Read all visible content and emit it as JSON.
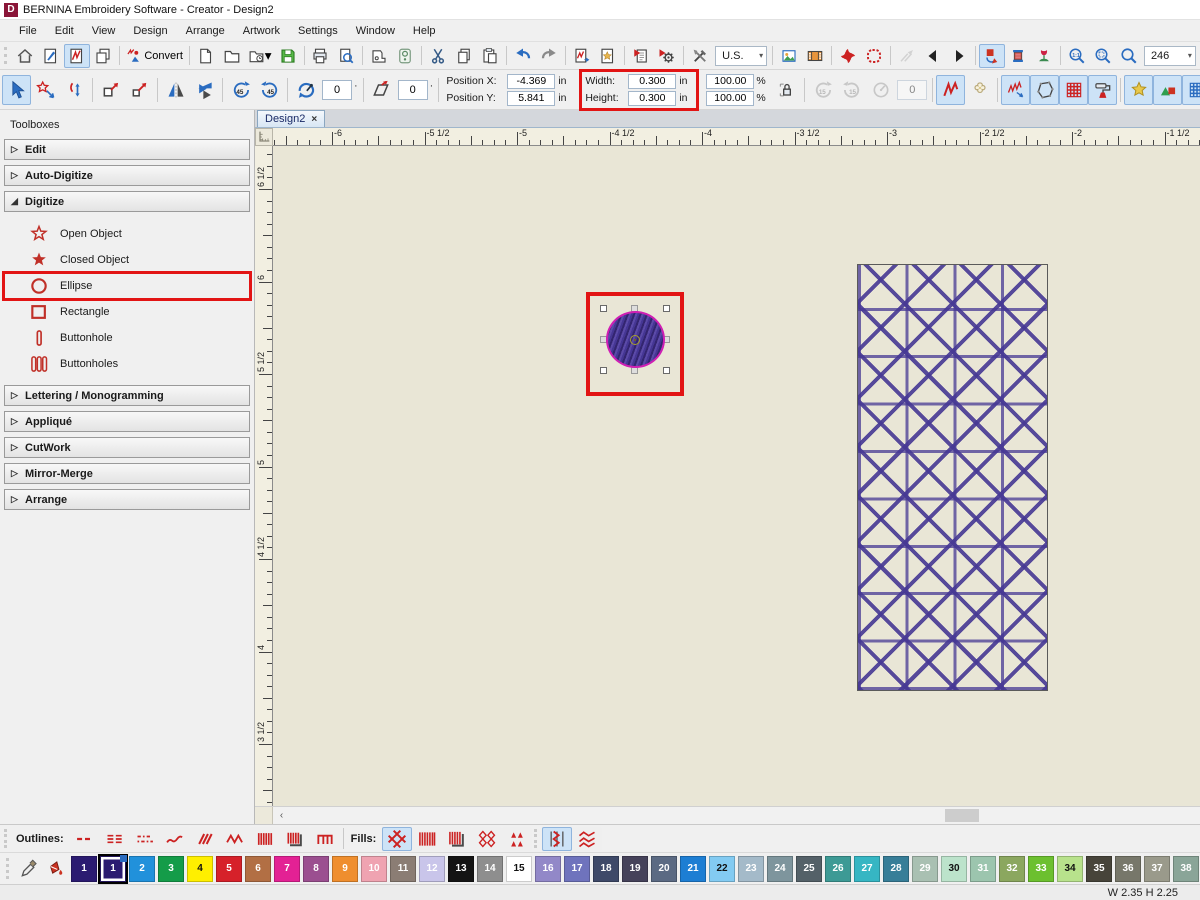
{
  "window": {
    "logo_letter": "D",
    "title": "BERNINA Embroidery Software - Creator - Design2"
  },
  "menu": {
    "items": [
      "File",
      "Edit",
      "View",
      "Design",
      "Arrange",
      "Artwork",
      "Settings",
      "Window",
      "Help"
    ]
  },
  "toolbar_main": {
    "groups": [
      {
        "items": [
          {
            "name": "home-button",
            "icon": "home"
          },
          {
            "name": "artwork-canvas-button",
            "icon": "pageBrush"
          },
          {
            "name": "embroidery-canvas-button",
            "icon": "pageStitch",
            "hl": true
          },
          {
            "name": "multi-hooping-button",
            "icon": "pages"
          }
        ]
      },
      {
        "items": [
          {
            "name": "convert-button",
            "icon": "convert",
            "label": "Convert"
          }
        ]
      },
      {
        "items": [
          {
            "name": "new-design-button",
            "icon": "pageNew"
          },
          {
            "name": "open-design-button",
            "icon": "folder"
          },
          {
            "name": "open-recent-button",
            "icon": "folderClock",
            "arrow": true
          },
          {
            "name": "save-design-button",
            "icon": "floppy"
          }
        ]
      },
      {
        "items": [
          {
            "name": "print-button",
            "icon": "printer"
          },
          {
            "name": "print-preview-button",
            "icon": "pageZoom"
          }
        ]
      },
      {
        "items": [
          {
            "name": "write-to-machine-button",
            "icon": "machine"
          },
          {
            "name": "send-to-hoop-button",
            "icon": "hoopDevice"
          }
        ]
      },
      {
        "items": [
          {
            "name": "cut-button",
            "icon": "cut"
          },
          {
            "name": "copy-button",
            "icon": "copy"
          },
          {
            "name": "paste-button",
            "icon": "paste"
          }
        ]
      },
      {
        "items": [
          {
            "name": "undo-button",
            "icon": "undo"
          },
          {
            "name": "redo-button",
            "icon": "redo"
          }
        ]
      },
      {
        "items": [
          {
            "name": "insert-embroidery-button",
            "icon": "pageZig"
          },
          {
            "name": "insert-artwork-button",
            "icon": "pageStar"
          }
        ]
      },
      {
        "items": [
          {
            "name": "design-properties-button",
            "icon": "docRed"
          },
          {
            "name": "options-button",
            "icon": "gearRed"
          }
        ]
      },
      {
        "items": [
          {
            "name": "quick-tools-button",
            "icon": "tools"
          },
          {
            "name": "units-combo",
            "combo": "U.S."
          }
        ]
      },
      {
        "items": [
          {
            "name": "background-picture-button",
            "icon": "picture"
          },
          {
            "name": "film-strip-button",
            "icon": "film"
          }
        ]
      },
      {
        "items": [
          {
            "name": "stitch-player-button",
            "icon": "pinwheel"
          },
          {
            "name": "show-hoop-button",
            "icon": "hoopDashed"
          }
        ]
      },
      {
        "items": [
          {
            "name": "slow-redraw-button",
            "icon": "slowRedraw",
            "dis": true
          },
          {
            "name": "previous-color-button",
            "icon": "triLeft"
          },
          {
            "name": "next-color-button",
            "icon": "triRight"
          }
        ]
      },
      {
        "items": [
          {
            "name": "color-change-button",
            "icon": "colorChange",
            "hl": true
          },
          {
            "name": "thread-colors-button",
            "icon": "spool"
          },
          {
            "name": "my-threads-button",
            "icon": "flowerRed"
          }
        ]
      },
      {
        "items": [
          {
            "name": "zoom-1to1-button",
            "icon": "zoom11"
          },
          {
            "name": "zoom-to-fit-button",
            "icon": "zoomFit"
          },
          {
            "name": "zoom-button",
            "icon": "zoomMag"
          },
          {
            "name": "zoom-level-combo",
            "combo": "246"
          }
        ]
      }
    ]
  },
  "toolbar_transform": {
    "items_a": [
      {
        "name": "select-button",
        "icon": "arrowSelect",
        "hl": true
      },
      {
        "name": "reshape-button",
        "icon": "reshapeStar"
      },
      {
        "name": "transform-node-button",
        "icon": "transformNode"
      },
      {
        "sep": true
      },
      {
        "name": "scale-handles-button",
        "icon": "scaleBox1"
      },
      {
        "name": "scale-center-button",
        "icon": "scaleBox2"
      },
      {
        "sep": true
      },
      {
        "name": "mirror-horizontal-button",
        "icon": "mirrorH"
      },
      {
        "name": "mirror-vertical-button",
        "icon": "mirrorV"
      },
      {
        "sep": true
      },
      {
        "name": "rotate-ccw-45-button",
        "icon": "rot45l"
      },
      {
        "name": "rotate-cw-45-button",
        "icon": "rot45r"
      },
      {
        "sep": true
      },
      {
        "name": "rotate-tool-button",
        "icon": "rotateFree"
      },
      {
        "name": "rotate-angle-input",
        "input": "0"
      },
      {
        "dot": true
      },
      {
        "sep": true
      },
      {
        "name": "skew-tool-button",
        "icon": "skew"
      },
      {
        "name": "skew-angle-input",
        "input": "0"
      },
      {
        "dot": true
      },
      {
        "sep": true
      }
    ],
    "items_b": [
      {
        "sep": true
      },
      {
        "name": "rotate-15-ccw-button",
        "icon": "rot15l",
        "dis": true
      },
      {
        "name": "rotate-15-cw-button",
        "icon": "rot15r",
        "dis": true
      },
      {
        "name": "rotate-dial-button",
        "icon": "dialGray",
        "dis": true
      },
      {
        "name": "rotate-dial-input",
        "input": "0",
        "dis": true
      },
      {
        "sep": true
      },
      {
        "name": "stitch-type-button",
        "icon": "zigzagRed",
        "hl": true
      },
      {
        "name": "craft-stitch-button",
        "icon": "flowerOutline"
      },
      {
        "sep": true
      },
      {
        "name": "show-stitches-button",
        "icon": "stitchesSmall",
        "hl": true
      },
      {
        "name": "show-outlines-button",
        "icon": "polygonIcon",
        "hl": true
      },
      {
        "name": "show-needle-points-button",
        "icon": "gridRed",
        "hl": true
      },
      {
        "name": "show-connectors-button",
        "icon": "roller",
        "hl": true
      },
      {
        "sep": true
      },
      {
        "name": "show-artwork-button",
        "icon": "starYellow",
        "hl": true
      },
      {
        "name": "show-vectors-button",
        "icon": "artShapes",
        "hl": true
      },
      {
        "name": "show-grid-overlay-button",
        "icon": "gridBlue",
        "hl": true
      },
      {
        "sep": true
      },
      {
        "name": "show-hoop-button-2",
        "icon": "hoopBlue"
      },
      {
        "name": "hoop-template-button",
        "icon": "hoopGrid"
      },
      {
        "name": "show-grid-button",
        "icon": "gridGray"
      },
      {
        "name": "show-rulers-button",
        "icon": "rulerIcon",
        "hl": true
      },
      {
        "sep": true
      },
      {
        "name": "overflow-button",
        "icon": "zigzagRed"
      }
    ],
    "position_x_label": "Position X:",
    "position_x_value": "-4.369",
    "position_x_unit": "in",
    "position_y_label": "Position Y:",
    "position_y_value": "5.841",
    "position_y_unit": "in",
    "width_label": "Width:",
    "width_value": "0.300",
    "width_unit": "in",
    "height_label": "Height:",
    "height_value": "0.300",
    "height_unit": "in",
    "scale_x_value": "100.00",
    "scale_x_unit": "%",
    "scale_y_value": "100.00",
    "scale_y_unit": "%"
  },
  "sidebar": {
    "title": "Toolboxes",
    "sections": [
      {
        "label": "Edit",
        "expanded": false
      },
      {
        "label": "Auto-Digitize",
        "expanded": false
      },
      {
        "label": "Digitize",
        "expanded": true,
        "items": [
          {
            "label": "Open Object",
            "icon": "starOpen",
            "name": "tool-open-object"
          },
          {
            "label": "Closed Object",
            "icon": "starFill",
            "name": "tool-closed-object"
          },
          {
            "label": "Ellipse",
            "icon": "circleO",
            "name": "tool-ellipse",
            "annotated": true
          },
          {
            "label": "Rectangle",
            "icon": "rectO",
            "name": "tool-rectangle"
          },
          {
            "label": "Buttonhole",
            "icon": "bh1",
            "name": "tool-buttonhole"
          },
          {
            "label": "Buttonholes",
            "icon": "bh3",
            "name": "tool-buttonholes"
          }
        ]
      },
      {
        "label": "Lettering / Monogramming",
        "expanded": false
      },
      {
        "label": "Appliqué",
        "expanded": false
      },
      {
        "label": "CutWork",
        "expanded": false
      },
      {
        "label": "Mirror-Merge",
        "expanded": false
      },
      {
        "label": "Arrange",
        "expanded": false
      }
    ]
  },
  "canvas": {
    "tab_label": "Design2",
    "tab_close": "×",
    "scroll_left_arrow": "‹",
    "ruler_h_labels": [
      "-6",
      "-5 1/2",
      "-5",
      "-4 1/2",
      "-4",
      "-3 1/2",
      "-3",
      "-2 1/2",
      "-2",
      "-1 1/2"
    ],
    "ruler_v_labels": [
      "6 1/2",
      "6",
      "5 1/2",
      "5",
      "4 1/2",
      "4",
      "3 1/2"
    ],
    "objects": {
      "selected_circle": {
        "fill_color": "#453694",
        "outline_color": "#cf1fb4",
        "width_in": "0.300",
        "height_in": "0.300"
      },
      "lattice_rectangle": {
        "fill_color": "#463894"
      }
    }
  },
  "stitch_bar": {
    "outlines_label": "Outlines:",
    "outline_icons": [
      {
        "name": "outline-single",
        "icon": "oRun"
      },
      {
        "name": "outline-triple",
        "icon": "oTriple"
      },
      {
        "name": "outline-sculpture",
        "icon": "oSculpt"
      },
      {
        "name": "outline-backstitch",
        "icon": "oBack"
      },
      {
        "name": "outline-stemstitch",
        "icon": "oStem"
      },
      {
        "name": "outline-zigzag",
        "icon": "oZig"
      },
      {
        "name": "outline-satin",
        "icon": "oSatin"
      },
      {
        "name": "outline-raised-satin",
        "icon": "oSatinR"
      },
      {
        "name": "outline-open-object",
        "icon": "oOpen"
      }
    ],
    "fills_label": "Fills:",
    "fill_icons": [
      {
        "name": "fill-lattice",
        "icon": "fLattice",
        "hl": true
      },
      {
        "name": "fill-satin",
        "icon": "fSatin"
      },
      {
        "name": "fill-raised-satin",
        "icon": "fSatinR"
      },
      {
        "name": "fill-pattern",
        "icon": "fPattern"
      },
      {
        "name": "fill-motif",
        "icon": "fMotif"
      }
    ],
    "extra_icons": [
      {
        "name": "fill-weave",
        "icon": "fWeave",
        "hl": true
      },
      {
        "name": "fill-zigzag-lines",
        "icon": "fZig2"
      }
    ]
  },
  "palette": {
    "tools": [
      {
        "name": "color-picker-tool",
        "icon": "eyedropper"
      },
      {
        "name": "fill-bucket-tool",
        "icon": "bucket"
      }
    ],
    "swatches": [
      {
        "n": "1",
        "c": "#2b1b71",
        "role": "current"
      },
      {
        "n": "1",
        "c": "#2b1b71",
        "role": "selected"
      },
      {
        "n": "2",
        "c": "#2191db"
      },
      {
        "n": "3",
        "c": "#149c49"
      },
      {
        "n": "4",
        "c": "#ffef00",
        "dark": true
      },
      {
        "n": "5",
        "c": "#d6212a"
      },
      {
        "n": "6",
        "c": "#b26f44"
      },
      {
        "n": "7",
        "c": "#e32194"
      },
      {
        "n": "8",
        "c": "#9b4f90"
      },
      {
        "n": "9",
        "c": "#ef8e2e"
      },
      {
        "n": "10",
        "c": "#efa3b1"
      },
      {
        "n": "11",
        "c": "#8b7d74"
      },
      {
        "n": "12",
        "c": "#c9c5ea"
      },
      {
        "n": "13",
        "c": "#141414"
      },
      {
        "n": "14",
        "c": "#8e8e8e"
      },
      {
        "n": "15",
        "c": "#ffffff",
        "dark": true
      },
      {
        "n": "16",
        "c": "#9288c8"
      },
      {
        "n": "17",
        "c": "#6f73bd"
      },
      {
        "n": "18",
        "c": "#3e4968"
      },
      {
        "n": "19",
        "c": "#45425a"
      },
      {
        "n": "20",
        "c": "#5b6a83"
      },
      {
        "n": "21",
        "c": "#1d7ed3"
      },
      {
        "n": "22",
        "c": "#83cbf2",
        "dark": true
      },
      {
        "n": "23",
        "c": "#a4bac9"
      },
      {
        "n": "24",
        "c": "#7e959d"
      },
      {
        "n": "25",
        "c": "#546168"
      },
      {
        "n": "26",
        "c": "#3d9a95"
      },
      {
        "n": "27",
        "c": "#36b6c3"
      },
      {
        "n": "28",
        "c": "#377e98"
      },
      {
        "n": "29",
        "c": "#a9c0b2"
      },
      {
        "n": "30",
        "c": "#bce3cb",
        "dark": true
      },
      {
        "n": "31",
        "c": "#9cc5ae"
      },
      {
        "n": "32",
        "c": "#8ba75f"
      },
      {
        "n": "33",
        "c": "#6cc02f"
      },
      {
        "n": "34",
        "c": "#b8e28c",
        "dark": true
      },
      {
        "n": "35",
        "c": "#47443a"
      },
      {
        "n": "36",
        "c": "#77776a"
      },
      {
        "n": "37",
        "c": "#9a9a8b"
      },
      {
        "n": "38",
        "c": "#8aa598"
      }
    ]
  },
  "status_bar": {
    "dimensions": "W 2.35 H 2.25"
  }
}
